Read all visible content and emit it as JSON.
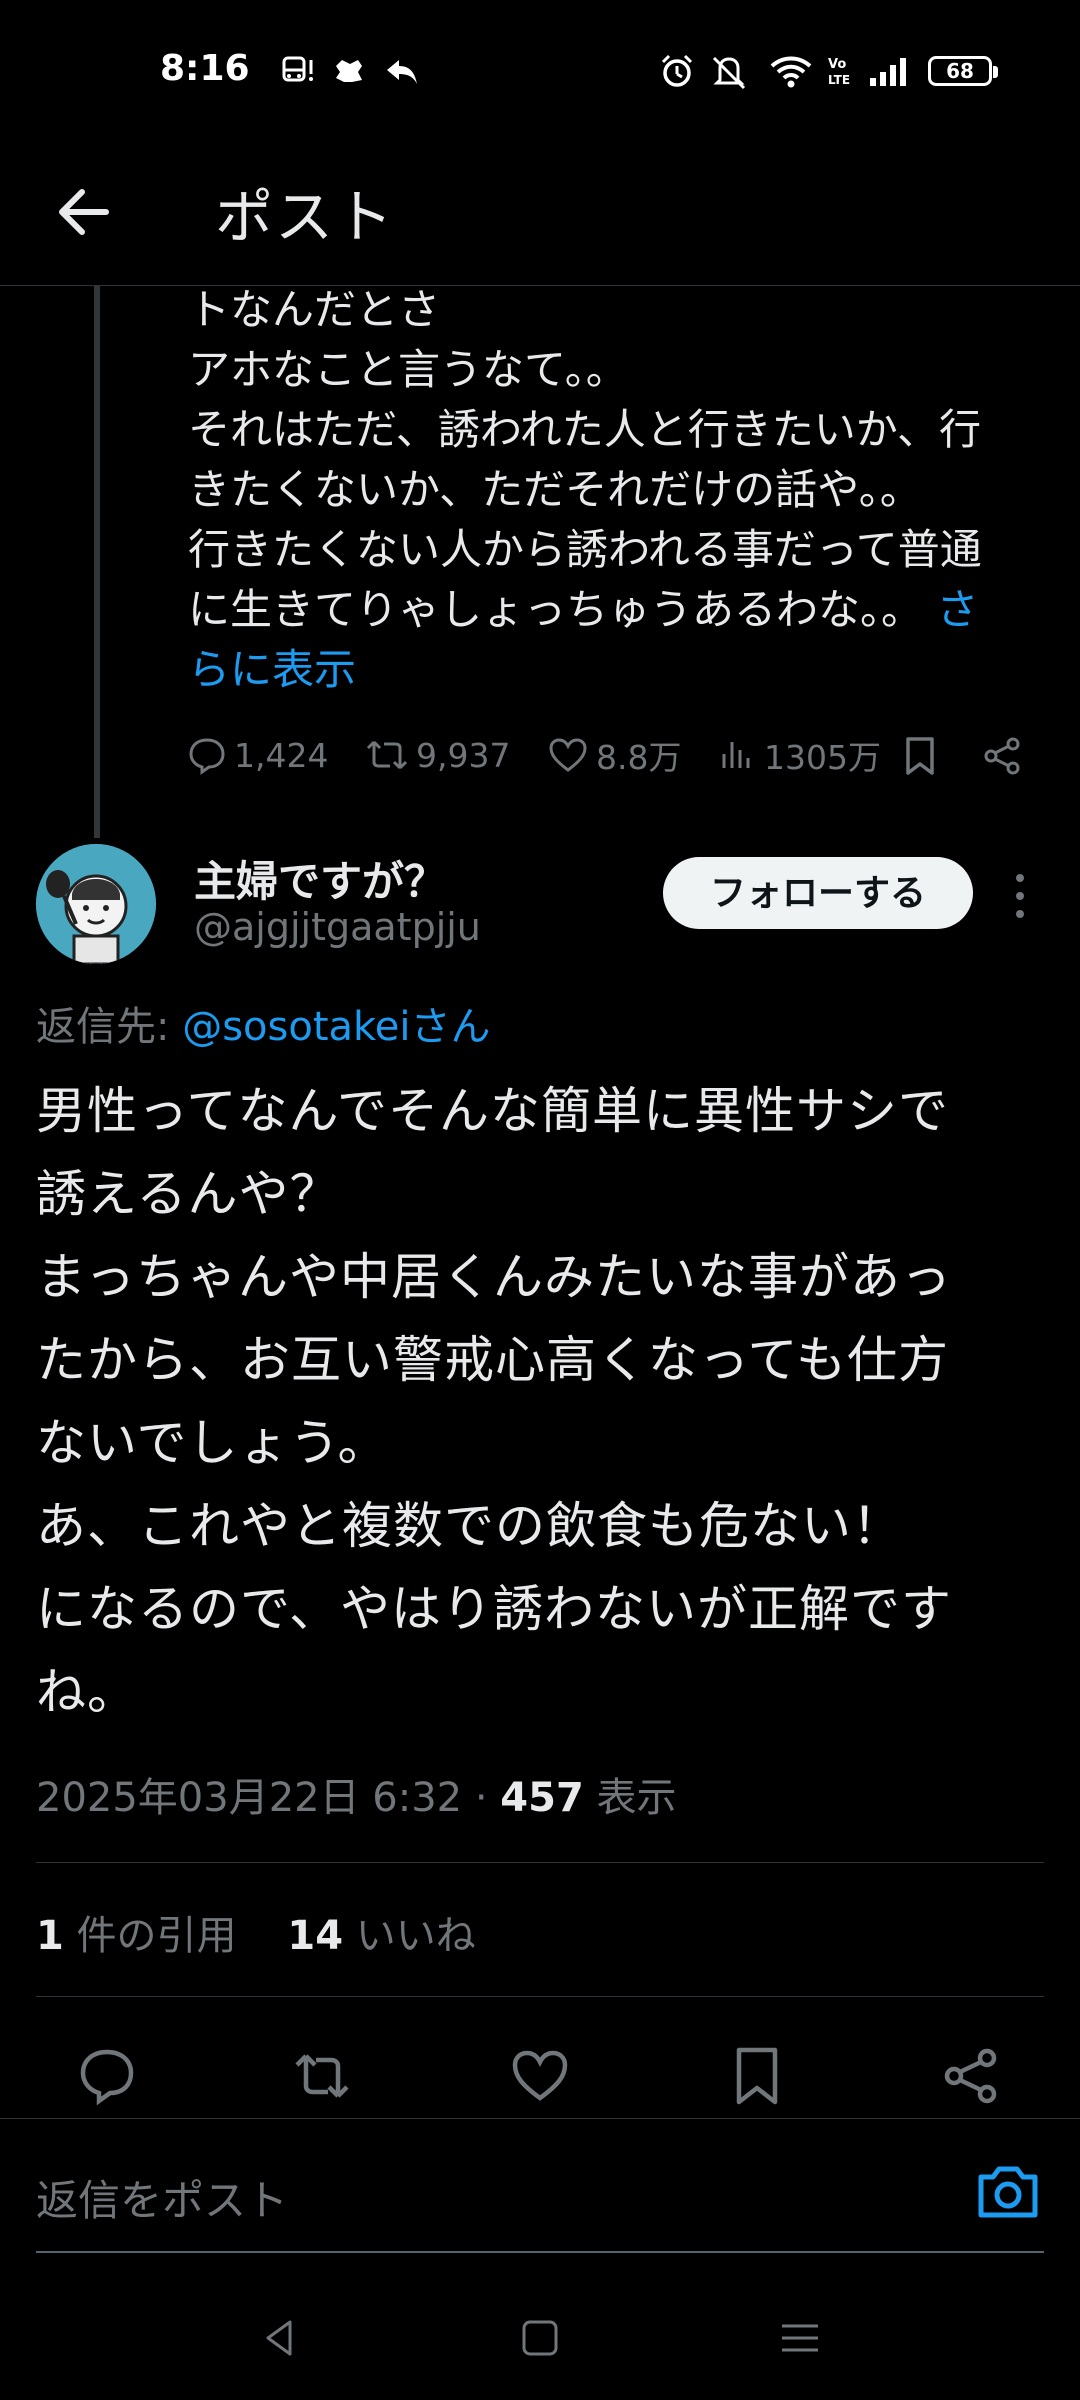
{
  "status_bar": {
    "time": "8:16",
    "battery": "68",
    "icons": [
      "bus-icon",
      "notification-icon",
      "reply-arrow-icon",
      "alarm-icon",
      "mute-icon",
      "wifi-icon",
      "volte-icon",
      "signal-icon"
    ]
  },
  "header": {
    "title": "ポスト"
  },
  "previous_post": {
    "lines": [
      "トなんだとさ",
      "アホなこと言うなて。。",
      "それはただ、誘われた人と行きたいか、行",
      "きたくないか、ただそれだけの話や。。",
      "行きたくない人から誘われる事だって普通",
      "に生きてりゃしょっちゅうあるわな。。"
    ],
    "show_more_part1": "さ",
    "show_more_part2": "らに表示",
    "replies": "1,424",
    "reposts": "9,937",
    "likes": "8.8万",
    "views": "1305万"
  },
  "post": {
    "display_name": "主婦ですが？",
    "handle": "@ajgjjtgaatpjju",
    "follow_label": "フォローする",
    "reply_to_prefix": "返信先: ",
    "reply_to_mention": "@sosotakeiさん",
    "body_lines": [
      "男性ってなんでそんな簡単に異性サシで",
      "誘えるんや？",
      "まっちゃんや中居くんみたいな事があっ",
      "たから、お互い警戒心高くなっても仕方",
      "ないでしょう。",
      "あ、これやと複数での飲食も危ない！",
      "になるので、やはり誘わないが正解です",
      "ね。"
    ],
    "timestamp": "2025年03月22日 6:32",
    "separator": " · ",
    "views_count": "457",
    "views_label": " 表示",
    "quotes_count": "1",
    "quotes_label": " 件の引用",
    "likes_count": "14",
    "likes_label": " いいね"
  },
  "compose": {
    "placeholder": "返信をポスト"
  },
  "colors": {
    "background": "#000000",
    "text": "#e7e9ea",
    "muted": "#71767b",
    "accent": "#1d9bf0",
    "divider": "#2f3336"
  }
}
